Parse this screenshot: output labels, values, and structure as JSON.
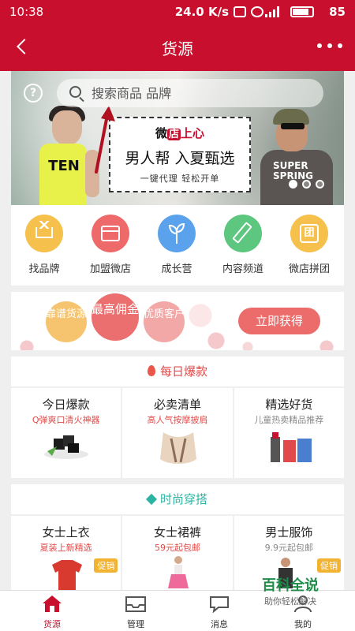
{
  "status_bar": {
    "time": "10:38",
    "network": "24.0 K/s",
    "battery": "85"
  },
  "header": {
    "title": "货源"
  },
  "search": {
    "placeholder": "搜索商品 品牌"
  },
  "banner": {
    "promo_logo_pre": "微",
    "promo_logo_mid": "店",
    "promo_logo_post": "上心",
    "promo_line1": "男人帮 入夏甄选",
    "promo_line2": "一键代理 轻松开单",
    "model1_shirt": "TEN",
    "model2_shirt": "SUPER SPRING",
    "slide_count": 3,
    "active_slide": 0
  },
  "quick": [
    {
      "label": "找品牌",
      "color": "#f5c14c"
    },
    {
      "label": "加盟微店",
      "color": "#ee6a6a"
    },
    {
      "label": "成长营",
      "color": "#5aa3ec"
    },
    {
      "label": "内容频道",
      "color": "#5dc67f"
    },
    {
      "label": "微店拼团",
      "color": "#f5c14c"
    }
  ],
  "recruit": {
    "bubble1": "靠谱货源",
    "bubble2": "最高佣金",
    "bubble3": "优质客户",
    "cta": "立即获得"
  },
  "daily": {
    "title": "每日爆款",
    "cards": [
      {
        "title": "今日爆款",
        "sub": "Q弹爽口清火神器"
      },
      {
        "title": "必卖清单",
        "sub": "高人气按摩披肩"
      },
      {
        "title": "精选好货",
        "sub": "儿童热卖精品推荐"
      }
    ]
  },
  "fashion": {
    "title": "时尚穿搭",
    "tag": "促销",
    "cards": [
      {
        "title": "女士上衣",
        "sub": "夏装上新精选"
      },
      {
        "title": "女士裙裤",
        "sub": "59元起包邮"
      },
      {
        "title": "男士服饰",
        "sub": "9.9元起包邮"
      }
    ]
  },
  "nav": [
    {
      "label": "货源",
      "icon": "home-icon",
      "active": true
    },
    {
      "label": "管理",
      "icon": "inbox-icon",
      "active": false
    },
    {
      "label": "消息",
      "icon": "message-icon",
      "active": false
    },
    {
      "label": "我的",
      "icon": "user-icon",
      "active": false
    }
  ],
  "watermark": {
    "title": "百科全说",
    "subtitle": "助你轻松解决"
  }
}
